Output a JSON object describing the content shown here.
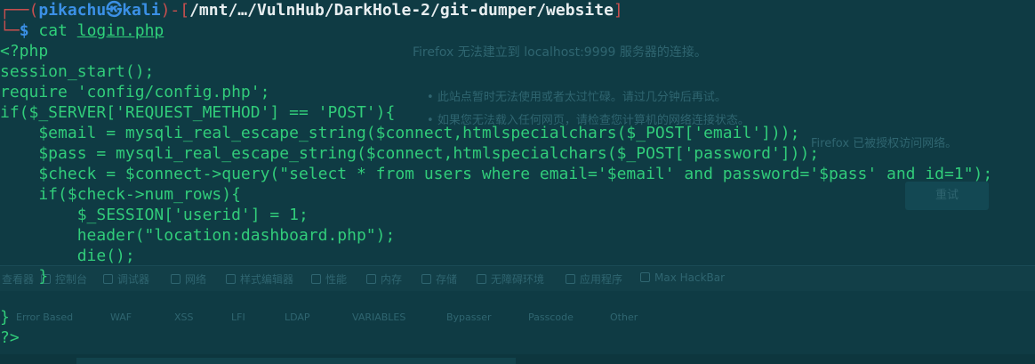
{
  "browser_ghost": {
    "error_title": "Firefox 无法建立到 localhost:9999 服务器的连接。",
    "error_bullets": [
      "此站点暂时无法使用或者太过忙碌。请过几分钟后再试。",
      "如果您无法载入任何网页，请检查您计算机的网络连接状态。",
      "Firefox 已被授权访问网络。"
    ],
    "retry_button": "重试",
    "devtools_tabs": [
      "查看器",
      "控制台",
      "调试器",
      "网络",
      "样式编辑器",
      "性能",
      "内存",
      "存储",
      "无障碍环境",
      "应用程序",
      "Max HackBar"
    ],
    "hackbar_menu": [
      "Error Based",
      "WAF",
      "XSS",
      "LFI",
      "LDAP",
      "VARIABLES",
      "Bypasser",
      "Passcode",
      "Other"
    ]
  },
  "terminal": {
    "prompt": {
      "open_prefix": "┌──(",
      "user": "pikachu",
      "at_symbol": "㉿",
      "host": "kali",
      "mid": ")-[",
      "path": "/mnt/…/VulnHub/DarkHole-2/git-dumper/website",
      "close": "]",
      "second_prefix": "└─",
      "dollar": "$ ",
      "command": "cat",
      "argument": "login.php"
    },
    "code_lines": [
      "<?php",
      "session_start();",
      "require 'config/config.php';",
      "if($_SERVER['REQUEST_METHOD'] == 'POST'){",
      "    $email = mysqli_real_escape_string($connect,htmlspecialchars($_POST['email']));",
      "    $pass = mysqli_real_escape_string($connect,htmlspecialchars($_POST['password']));",
      "    $check = $connect->query(\"select * from users where email='$email' and password='$pass' and id=1\");",
      "    if($check->num_rows){",
      "        $_SESSION['userid'] = 1;",
      "        header(\"location:dashboard.php\");",
      "        die();",
      "    }",
      "",
      "}",
      "?>"
    ]
  }
}
